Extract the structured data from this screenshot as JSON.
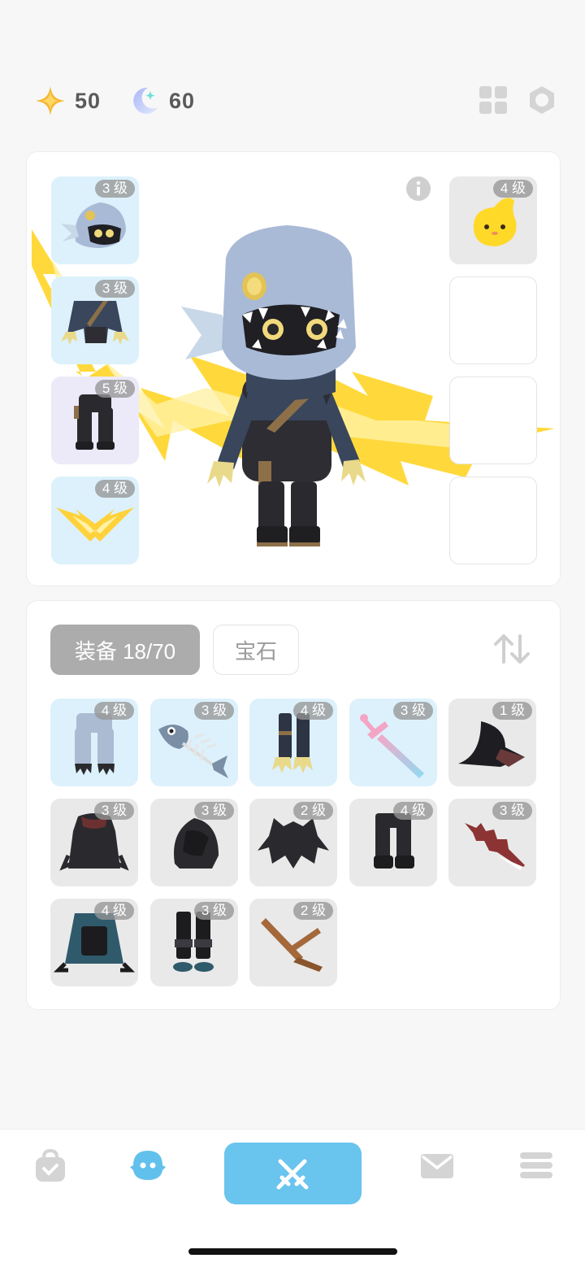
{
  "currency": {
    "star": {
      "icon": "star-icon",
      "value": "50"
    },
    "moon": {
      "icon": "moon-icon",
      "value": "60"
    }
  },
  "top_actions": [
    {
      "icon": "grid-icon"
    },
    {
      "icon": "hexagon-settings-icon"
    }
  ],
  "character": {
    "info_icon": "info-icon",
    "left_slots": [
      {
        "level": "3 级",
        "icon": "fish-helmet-icon",
        "tone": "blue"
      },
      {
        "level": "3 级",
        "icon": "ninja-armor-icon",
        "tone": "blue"
      },
      {
        "level": "5 级",
        "icon": "dark-pants-icon",
        "tone": "purple"
      },
      {
        "level": "4 级",
        "icon": "lightning-wings-icon",
        "tone": "blue"
      }
    ],
    "right_slots": [
      {
        "level": "4 级",
        "icon": "yellow-pet-icon",
        "tone": "gray"
      },
      {
        "level": "",
        "icon": "",
        "tone": "empty"
      },
      {
        "level": "",
        "icon": "",
        "tone": "empty"
      },
      {
        "level": "",
        "icon": "",
        "tone": "empty"
      }
    ]
  },
  "inventory": {
    "tabs": {
      "equipment": "装备 18/70",
      "gems": "宝石"
    },
    "sort_icon": "sort-arrows-icon",
    "items": [
      {
        "level": "4 级",
        "icon": "light-pants-icon",
        "tone": "blue"
      },
      {
        "level": "3 级",
        "icon": "fish-bone-icon",
        "tone": "blue"
      },
      {
        "level": "4 级",
        "icon": "claw-boots-icon",
        "tone": "blue"
      },
      {
        "level": "3 级",
        "icon": "pink-sword-icon",
        "tone": "blue"
      },
      {
        "level": "1 级",
        "icon": "witch-hat-icon",
        "tone": "gray"
      },
      {
        "level": "3 级",
        "icon": "dark-robe-icon",
        "tone": "gray"
      },
      {
        "level": "3 级",
        "icon": "dark-hood-icon",
        "tone": "gray"
      },
      {
        "level": "2 级",
        "icon": "spiky-armor-icon",
        "tone": "gray"
      },
      {
        "level": "4 级",
        "icon": "black-pants-icon",
        "tone": "gray"
      },
      {
        "level": "3 级",
        "icon": "red-blade-icon",
        "tone": "gray"
      },
      {
        "level": "4 级",
        "icon": "teal-cape-icon",
        "tone": "gray"
      },
      {
        "level": "3 级",
        "icon": "black-boots-icon",
        "tone": "gray"
      },
      {
        "level": "2 级",
        "icon": "wooden-branch-icon",
        "tone": "gray"
      }
    ]
  },
  "bottom_nav": [
    {
      "icon": "bag-icon"
    },
    {
      "icon": "character-face-icon"
    },
    {
      "icon": "crossed-swords-icon"
    },
    {
      "icon": "mail-icon"
    },
    {
      "icon": "menu-icon"
    }
  ]
}
